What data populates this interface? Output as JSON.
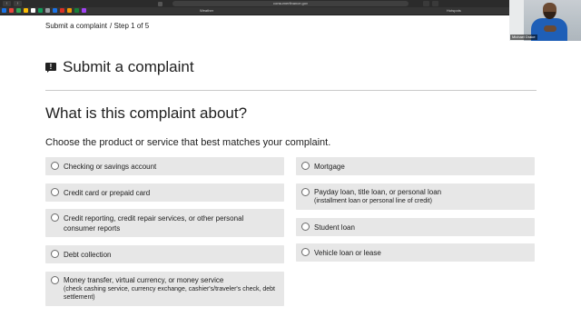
{
  "browser": {
    "url": "consumerfinance.gov",
    "bookmark_left": "Weather",
    "bookmark_right": "Hotspots"
  },
  "breadcrumb": {
    "title": "Submit a complaint",
    "step": "/ Step 1 of 5"
  },
  "page": {
    "title": "Submit a complaint",
    "question": "What is this complaint about?",
    "instruction": "Choose the product or service that best matches your complaint."
  },
  "options_left": [
    {
      "label": "Checking or savings account",
      "sub": ""
    },
    {
      "label": "Credit card or prepaid card",
      "sub": ""
    },
    {
      "label": "Credit reporting, credit repair services, or other personal consumer reports",
      "sub": ""
    },
    {
      "label": "Debt collection",
      "sub": ""
    },
    {
      "label": "Money transfer, virtual currency, or money service",
      "sub": "(check cashing service, currency exchange, cashier's/traveler's check, debt settlement)"
    }
  ],
  "options_right": [
    {
      "label": "Mortgage",
      "sub": ""
    },
    {
      "label": "Payday loan, title loan, or personal loan",
      "sub": "(installment loan or personal line of credit)"
    },
    {
      "label": "Student loan",
      "sub": ""
    },
    {
      "label": "Vehicle loan or lease",
      "sub": ""
    }
  ],
  "webcam": {
    "name": "Michael Drake"
  },
  "colors": {
    "option_bg": "#e7e7e7",
    "text": "#212121",
    "divider": "#c9c9c9"
  }
}
